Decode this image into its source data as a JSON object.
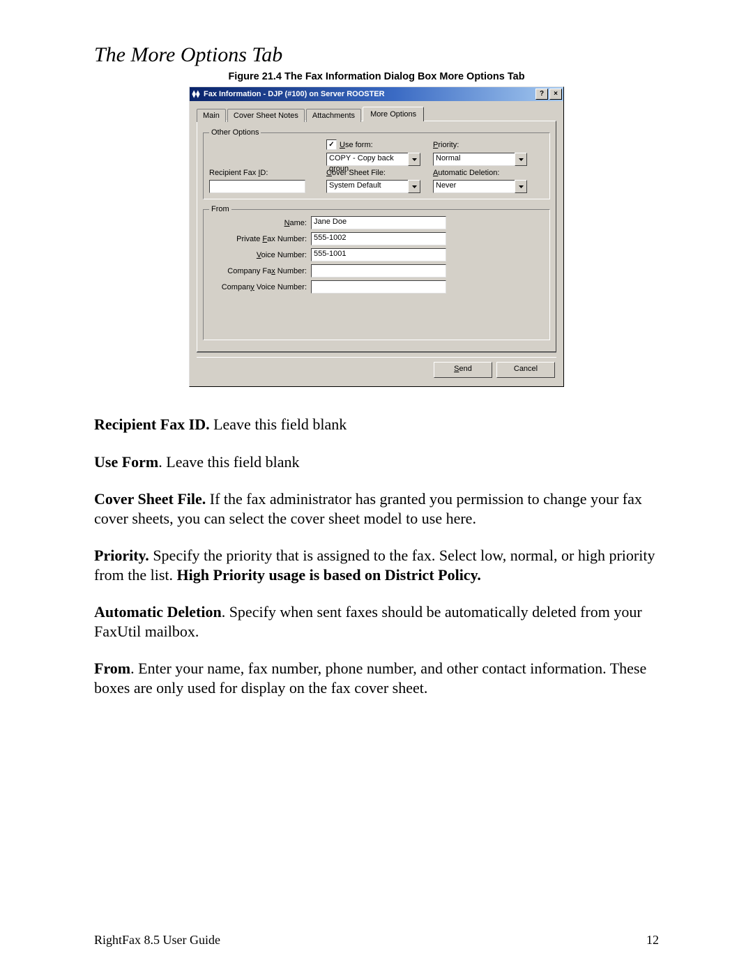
{
  "page": {
    "heading": "The More Options Tab",
    "figure_caption": "Figure 21.4  The Fax Information Dialog Box More Options Tab",
    "footer_left": "RightFax 8.5 User Guide",
    "footer_right": "12"
  },
  "dialog": {
    "title": "Fax Information - DJP (#100) on Server ROOSTER",
    "help_btn": "?",
    "close_btn": "×",
    "tabs": {
      "main": "Main",
      "cover": "Cover Sheet Notes",
      "attach": "Attachments",
      "more": "More Options"
    },
    "groups": {
      "other_options": "Other Options",
      "from": "From"
    },
    "labels": {
      "use_form_pre": "U",
      "use_form": "se form:",
      "use_form_value": "COPY - Copy back groun…",
      "priority_pre": "P",
      "priority": "riority:",
      "priority_value": "Normal",
      "recipient_id_pre": "Recipient Fax ",
      "recipient_id_u": "I",
      "recipient_id_post": "D:",
      "cover_file_pre": "C",
      "cover_file": "over Sheet File:",
      "cover_file_value": "System Default",
      "auto_del_pre": "A",
      "auto_del": "utomatic Deletion:",
      "auto_del_value": "Never",
      "name_pre": "N",
      "name": "ame:",
      "priv_fax_pre": "Private ",
      "priv_fax_u": "F",
      "priv_fax_post": "ax Number:",
      "voice_u": "V",
      "voice_post": "oice Number:",
      "comp_fax_pre": "Company Fa",
      "comp_fax_u": "x",
      "comp_fax_post": " Number:",
      "comp_voice_pre": "Compan",
      "comp_voice_u": "y",
      "comp_voice_post": " Voice Number:"
    },
    "values": {
      "recipient_id": "",
      "name": "Jane Doe",
      "priv_fax": "555-1002",
      "voice": "555-1001",
      "comp_fax": "",
      "comp_voice": ""
    },
    "buttons": {
      "send_u": "S",
      "send": "end",
      "cancel": "Cancel"
    }
  },
  "body": {
    "p1_b": "Recipient Fax ID.",
    "p1": "  Leave this field blank",
    "p2_b": "Use Form",
    "p2": ". Leave this field blank",
    "p3_b": "Cover Sheet File.",
    "p3": " If the fax administrator has granted you permission to change your fax cover sheets, you can select the cover sheet model to use here.",
    "p4_b": "Priority.",
    "p4_a": " Specify the priority that is assigned to the fax. Select low, normal, or high priority from the list.  ",
    "p4_b2": "High Priority usage is based on District Policy.",
    "p5_b": "Automatic Deletion",
    "p5": ". Specify when sent faxes should be automatically deleted from your FaxUtil mailbox.",
    "p6_b": "From",
    "p6": ". Enter your name, fax number, phone number, and other contact information. These boxes are only used for display on the fax cover sheet."
  }
}
